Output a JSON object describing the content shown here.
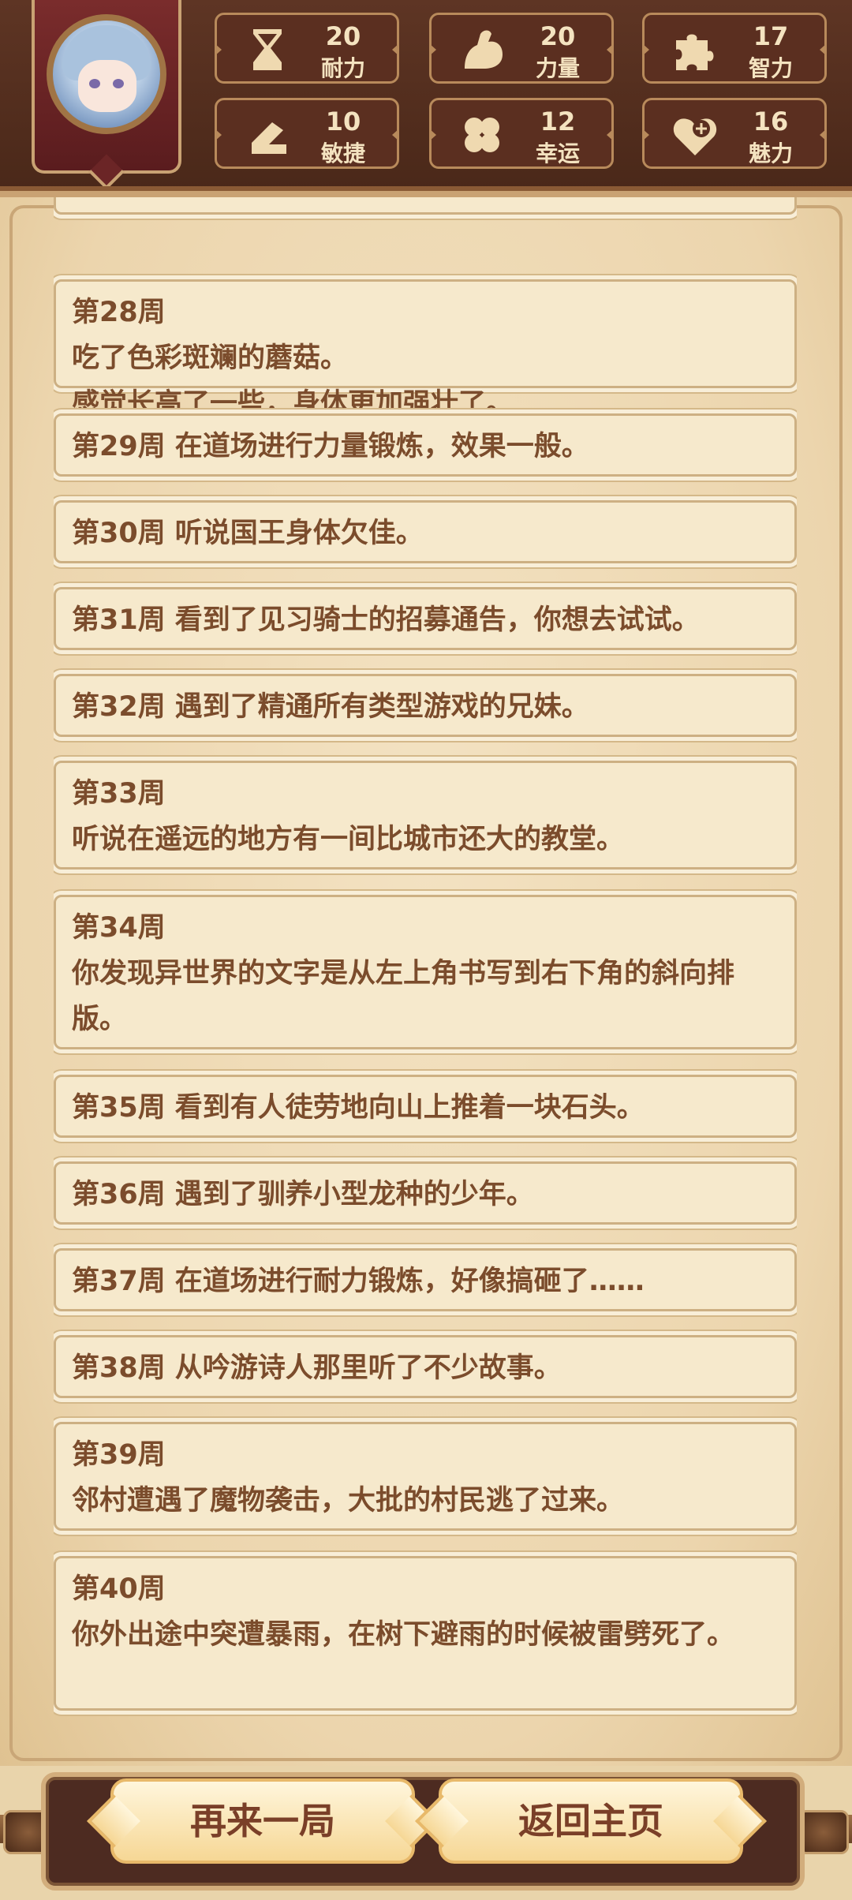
{
  "stats": [
    {
      "value": "20",
      "label": "耐力",
      "icon": "hourglass-icon"
    },
    {
      "value": "20",
      "label": "力量",
      "icon": "flexed-arm-icon"
    },
    {
      "value": "17",
      "label": "智力",
      "icon": "puzzle-icon"
    },
    {
      "value": "10",
      "label": "敏捷",
      "icon": "boot-icon"
    },
    {
      "value": "12",
      "label": "幸运",
      "icon": "clover-icon"
    },
    {
      "value": "16",
      "label": "魅力",
      "icon": "heart-plus-icon"
    }
  ],
  "log": [
    {
      "week": "",
      "text": ""
    },
    {
      "week": "第28周",
      "text": "吃了色彩斑斓的蘑菇。",
      "text2": "感觉长高了一些，身体更加强壮了。"
    },
    {
      "week": "第29周",
      "text": "在道场进行力量锻炼，效果一般。"
    },
    {
      "week": "第30周",
      "text": "听说国王身体欠佳。"
    },
    {
      "week": "第31周",
      "text": "看到了见习骑士的招募通告，你想去试试。"
    },
    {
      "week": "第32周",
      "text": "遇到了精通所有类型游戏的兄妹。"
    },
    {
      "week": "第33周",
      "text": "听说在遥远的地方有一间比城市还大的教堂。"
    },
    {
      "week": "第34周",
      "text": "你发现异世界的文字是从左上角书写到右下角的斜向排版。"
    },
    {
      "week": "第35周",
      "text": "看到有人徒劳地向山上推着一块石头。"
    },
    {
      "week": "第36周",
      "text": "遇到了驯养小型龙种的少年。"
    },
    {
      "week": "第37周",
      "text": "在道场进行耐力锻炼，好像搞砸了……"
    },
    {
      "week": "第38周",
      "text": "从吟游诗人那里听了不少故事。"
    },
    {
      "week": "第39周",
      "text": "邻村遭遇了魔物袭击，大批的村民逃了过来。"
    },
    {
      "week": "第40周",
      "text": "你外出途中突遭暴雨，在树下避雨的时候被雷劈死了。"
    }
  ],
  "buttons": {
    "replay": "再来一局",
    "home": "返回主页"
  }
}
